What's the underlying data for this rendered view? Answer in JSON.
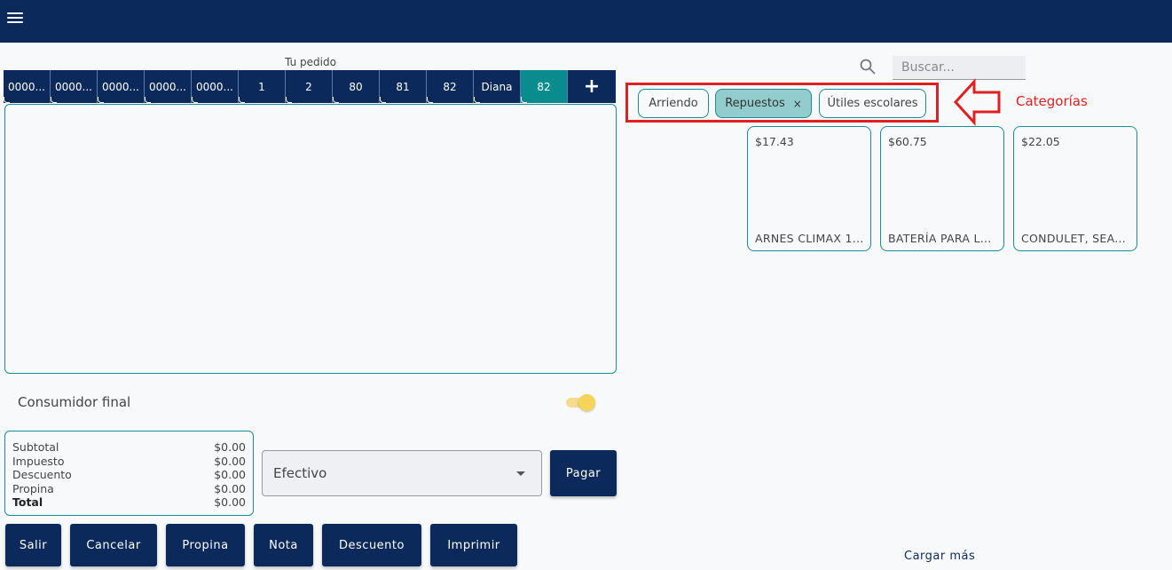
{
  "header": {
    "menu_icon": "hamburger-menu-icon"
  },
  "order": {
    "title": "Tu pedido",
    "tabs": [
      "0000...",
      "0000...",
      "0000...",
      "0000...",
      "0000...",
      "1",
      "2",
      "80",
      "81",
      "82",
      "Diana",
      "82"
    ],
    "active_tab_index": 11,
    "add_tab_label": "+"
  },
  "consumer": {
    "label": "Consumidor final",
    "toggle_on": true
  },
  "summary": {
    "rows": [
      {
        "label": "Subtotal",
        "value": "$0.00"
      },
      {
        "label": "Impuesto",
        "value": "$0.00"
      },
      {
        "label": "Descuento",
        "value": "$0.00"
      },
      {
        "label": "Propina",
        "value": "$0.00"
      },
      {
        "label": "Total",
        "value": "$0.00"
      }
    ]
  },
  "payment": {
    "selected": "Efectivo",
    "pay_label": "Pagar"
  },
  "actions": [
    "Salir",
    "Cancelar",
    "Propina",
    "Nota",
    "Descuento",
    "Imprimir"
  ],
  "search": {
    "placeholder": "Buscar..."
  },
  "categories": {
    "items": [
      {
        "label": "Arriendo",
        "selected": false
      },
      {
        "label": "Repuestos",
        "selected": true,
        "remove_label": "×"
      },
      {
        "label": "Útiles escolares",
        "selected": false
      }
    ],
    "annotation_label": "Categorías",
    "annotation_color": "#e02020"
  },
  "products": [
    {
      "price": "$17.43",
      "name": "ARNES CLIMAX 1..."
    },
    {
      "price": "$60.75",
      "name": "BATERÍA PARA L..."
    },
    {
      "price": "$22.05",
      "name": "CONDULET, SEA..."
    }
  ],
  "load_more": "Cargar más",
  "colors": {
    "primary": "#0b2a5b",
    "accent": "#0a8c8f",
    "border": "#1a8e94",
    "chip_selected": "#93cccd",
    "toggle": "#f5d458"
  }
}
